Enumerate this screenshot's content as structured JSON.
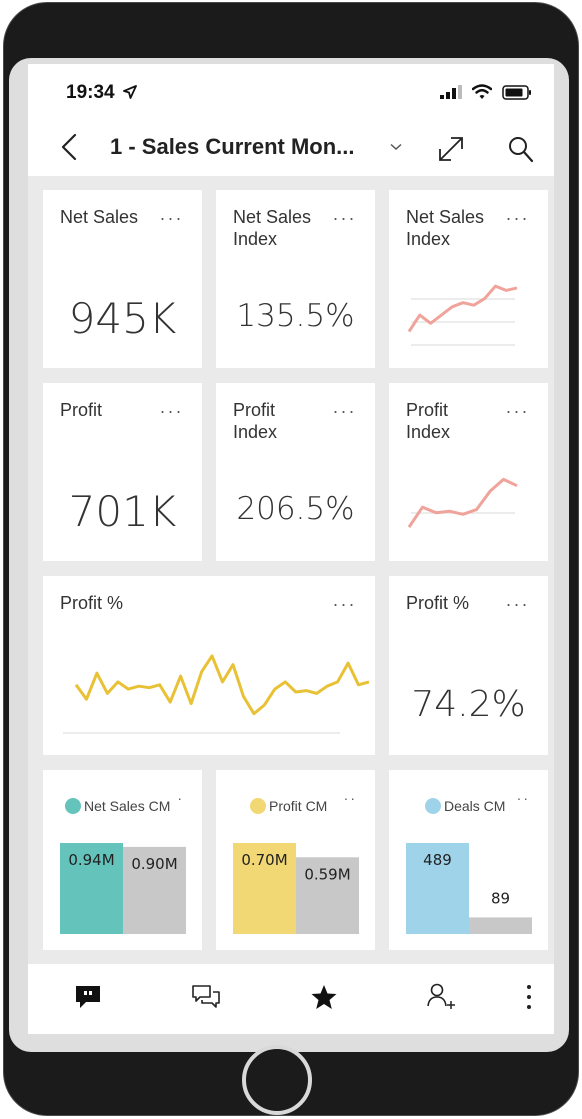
{
  "status_bar": {
    "time": "19:34"
  },
  "header": {
    "title": "1 - Sales Current Mon..."
  },
  "tiles": {
    "net_sales": {
      "title": "Net Sales",
      "value": "945K"
    },
    "net_sales_index": {
      "title": "Net Sales\nIndex",
      "value": "135.5%"
    },
    "net_sales_index_trend": {
      "title": "Net Sales\nIndex",
      "line_color": "#f0a39a"
    },
    "profit": {
      "title": "Profit",
      "value": "701K"
    },
    "profit_index": {
      "title": "Profit\nIndex",
      "value": "206.5%"
    },
    "profit_index_trend": {
      "title": "Profit\nIndex",
      "line_color": "#f0a39a"
    },
    "profit_pct_trend": {
      "title": "Profit %",
      "line_color": "#e8c135"
    },
    "profit_pct": {
      "title": "Profit %",
      "value": "74.2%"
    }
  },
  "more_label": "...",
  "bar_tiles": {
    "net_sales_cm": {
      "legend": "Net Sales CM",
      "color": "#64c3bb",
      "values": [
        "0.94M",
        "0.90M"
      ]
    },
    "profit_cm": {
      "legend": "Profit CM",
      "color": "#f2d875",
      "values": [
        "0.70M",
        "0.59M"
      ]
    },
    "deals_cm": {
      "legend": "Deals CM",
      "color": "#9fd3ea",
      "values": [
        "489",
        "89"
      ]
    }
  },
  "chart_data": [
    {
      "type": "line",
      "series": [
        {
          "values": [
            3,
            5,
            4,
            5,
            6,
            6.5,
            6.2,
            7,
            8.5,
            8,
            8.3
          ]
        }
      ]
    },
    {
      "type": "line",
      "series": [
        {
          "values": [
            2,
            4.5,
            3.8,
            4,
            3.6,
            4.2,
            6.5,
            8,
            7.2
          ]
        }
      ]
    },
    {
      "type": "line",
      "series": [
        {
          "values": [
            58,
            48,
            66,
            52,
            60,
            55,
            57,
            56,
            58,
            46,
            64,
            45,
            67,
            78,
            60,
            72,
            50,
            38,
            44,
            55,
            60,
            53,
            54,
            52,
            57,
            60,
            73,
            58,
            60
          ]
        }
      ]
    },
    {
      "type": "bar",
      "categories": [
        "",
        ""
      ],
      "values": [
        0.94,
        0.9
      ]
    },
    {
      "type": "bar",
      "categories": [
        "",
        ""
      ],
      "values": [
        0.7,
        0.59
      ]
    },
    {
      "type": "bar",
      "categories": [
        "",
        ""
      ],
      "values": [
        489,
        89
      ]
    }
  ]
}
